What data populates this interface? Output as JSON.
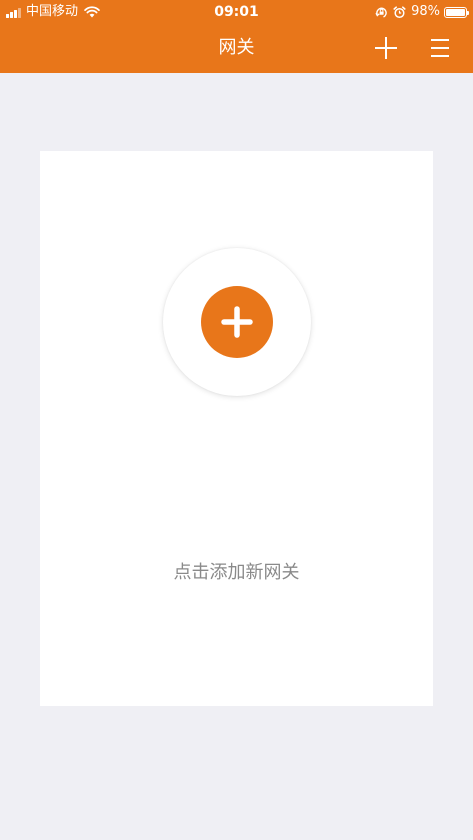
{
  "status_bar": {
    "carrier": "中国移动",
    "time": "09:01",
    "battery_percent": "98%",
    "battery_level": 0.98,
    "signal_bars_active": 3,
    "signal_bars_total": 4,
    "icons": [
      "signal-icon",
      "wifi-icon",
      "orientation-lock-icon",
      "alarm-icon",
      "battery-icon"
    ]
  },
  "nav": {
    "title": "网关",
    "add_icon": "plus-icon",
    "menu_icon": "menu-icon"
  },
  "card": {
    "add_button_icon": "plus-icon",
    "hint_text": "点击添加新网关"
  },
  "colors": {
    "brand": "#e8761a",
    "background": "#efeff4",
    "card": "#ffffff",
    "hint_text": "#8a8a8a"
  }
}
